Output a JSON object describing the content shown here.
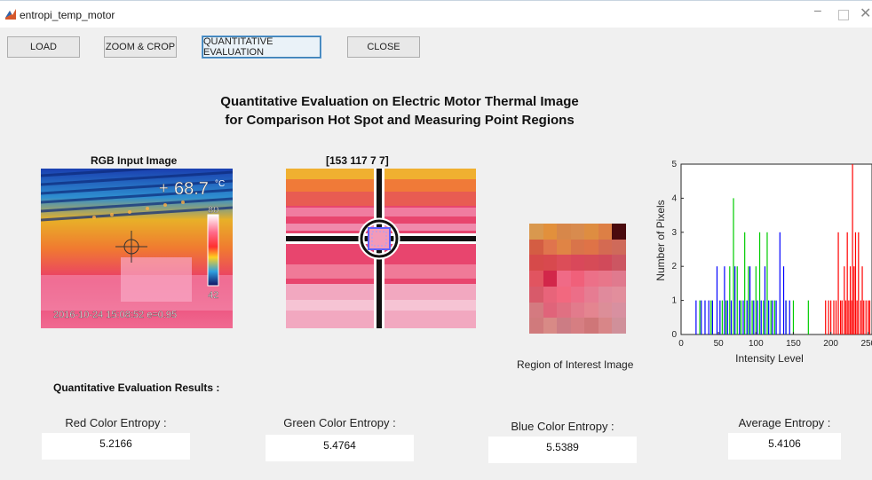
{
  "window": {
    "title": "entropi_temp_motor",
    "minimize": "–",
    "close": "✕"
  },
  "toolbar": {
    "load": "LOAD",
    "zoom_crop": "ZOOM & CROP",
    "quant_eval": "QUANTITATIVE EVALUATION",
    "close": "CLOSE"
  },
  "heading": {
    "line1": "Quantitative Evaluation on Electric Motor Thermal Image",
    "line2": "for Comparison Hot Spot and Measuring Point Regions"
  },
  "rgb_panel": {
    "title": "RGB Input Image",
    "temp_reading": "68.7",
    "temp_unit": "°C",
    "scale_max": "80",
    "scale_min": "42",
    "timestamp": "2016-10-24 15:08:52 e=0.95"
  },
  "zoom_panel": {
    "title": "[153 117 7 7]"
  },
  "roi_panel": {
    "caption": "Region of Interest Image",
    "pixels": [
      [
        "#d9984e",
        "#e2903c",
        "#d7874a",
        "#d88b4e",
        "#de8d41",
        "#dd7f45",
        "#4a0a0e"
      ],
      [
        "#d45d43",
        "#e0744d",
        "#e08445",
        "#d9744a",
        "#df7347",
        "#d46a52",
        "#cf6a5a"
      ],
      [
        "#d64a4a",
        "#d8494e",
        "#dc4d58",
        "#d9485a",
        "#d64b57",
        "#d14a5a",
        "#cc5662"
      ],
      [
        "#e15460",
        "#d2274a",
        "#f06a86",
        "#f0607a",
        "#ec7088",
        "#e8768a",
        "#e07a8e"
      ],
      [
        "#d85a6a",
        "#e8647a",
        "#f2687f",
        "#ec6e88",
        "#e67c92",
        "#e08a9c",
        "#e28e9c"
      ],
      [
        "#d47a80",
        "#e0647a",
        "#e07082",
        "#e27b8c",
        "#e48590",
        "#dc8e98",
        "#d890a0"
      ],
      [
        "#d07a7c",
        "#d88a86",
        "#cc7c84",
        "#d67e82",
        "#cf7678",
        "#d88688",
        "#d0909a"
      ]
    ]
  },
  "histogram": {
    "ylabel": "Number of Pixels",
    "xlabel": "Intensity Level",
    "x_ticks": [
      "0",
      "50",
      "100",
      "150",
      "200",
      "250"
    ],
    "y_ticks": [
      "0",
      "1",
      "2",
      "3",
      "4",
      "5"
    ],
    "colors": {
      "red": "#ff0000",
      "green": "#00cc00",
      "blue": "#0000ff"
    }
  },
  "chart_data": {
    "type": "bar",
    "xlabel": "Intensity Level",
    "ylabel": "Number of Pixels",
    "xlim": [
      0,
      255
    ],
    "ylim": [
      0,
      5
    ],
    "series": [
      {
        "name": "Red",
        "x": [
          193,
          197,
          200,
          204,
          207,
          210,
          213,
          215,
          218,
          220,
          222,
          224,
          226,
          228,
          229,
          231,
          233,
          235,
          237,
          240,
          242,
          244,
          247,
          250,
          252
        ],
        "values": [
          1,
          1,
          1,
          1,
          1,
          3,
          1,
          1,
          2,
          1,
          3,
          1,
          2,
          1,
          5,
          2,
          3,
          1,
          3,
          1,
          2,
          1,
          1,
          1,
          1
        ]
      },
      {
        "name": "Green",
        "x": [
          25,
          40,
          55,
          60,
          65,
          70,
          75,
          80,
          85,
          90,
          95,
          100,
          105,
          110,
          115,
          120,
          125,
          140,
          150,
          170
        ],
        "values": [
          1,
          1,
          1,
          1,
          2,
          4,
          2,
          1,
          3,
          2,
          1,
          2,
          3,
          1,
          3,
          1,
          1,
          1,
          1,
          1
        ]
      },
      {
        "name": "Blue",
        "x": [
          20,
          27,
          32,
          37,
          42,
          48,
          52,
          58,
          62,
          67,
          72,
          78,
          83,
          88,
          92,
          97,
          102,
          107,
          112,
          117,
          122,
          127,
          132,
          137,
          140,
          145
        ],
        "values": [
          1,
          1,
          1,
          1,
          1,
          2,
          1,
          2,
          1,
          1,
          2,
          1,
          1,
          1,
          2,
          1,
          1,
          1,
          2,
          1,
          1,
          1,
          3,
          2,
          1,
          1
        ]
      }
    ]
  },
  "results": {
    "heading": "Quantitative Evaluation Results :",
    "red_label": "Red Color Entropy :",
    "red_value": "5.2166",
    "green_label": "Green Color Entropy :",
    "green_value": "5.4764",
    "blue_label": "Blue Color Entropy :",
    "blue_value": "5.5389",
    "avg_label": "Average Entropy :",
    "avg_value": "5.4106"
  }
}
